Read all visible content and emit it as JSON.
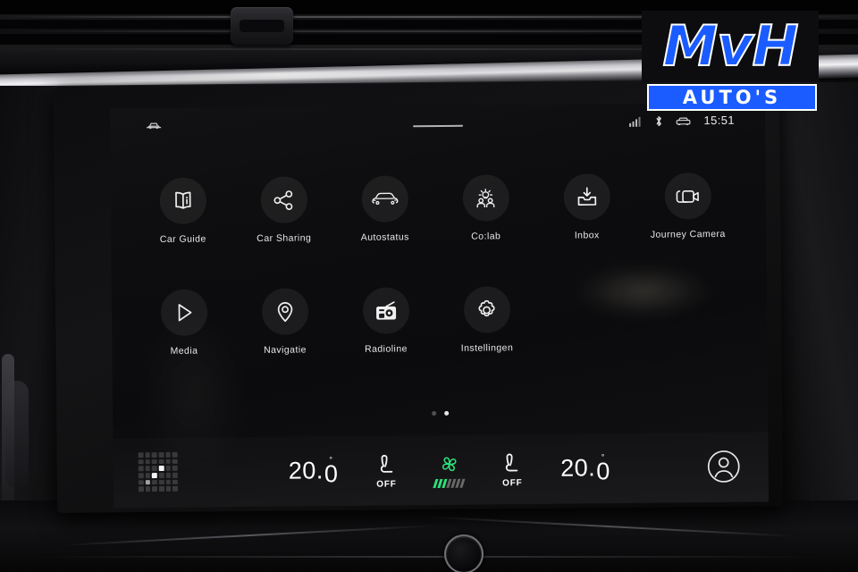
{
  "watermark": {
    "brand": "MvH",
    "tagline": "AUTO'S",
    "brand_color": "#1a5cff",
    "outline_color": "#ffffff"
  },
  "screen": {
    "status_bar": {
      "vehicle_icon": "car-icon",
      "signal_icon": "signal-bars-icon",
      "bluetooth_icon": "bluetooth-icon",
      "car_status_icon": "car-front-icon",
      "time": "15:51",
      "pull_handle": "drag-handle"
    },
    "apps": [
      [
        {
          "label": "Car Guide",
          "icon": "book-icon"
        },
        {
          "label": "Car Sharing",
          "icon": "share-icon"
        },
        {
          "label": "Autostatus",
          "icon": "car-front-icon"
        },
        {
          "label": "Co:lab",
          "icon": "collaboration-idea-icon"
        },
        {
          "label": "Inbox",
          "icon": "inbox-download-icon"
        },
        {
          "label": "Journey Camera",
          "icon": "video-camera-icon"
        }
      ],
      [
        {
          "label": "Media",
          "icon": "play-triangle-icon"
        },
        {
          "label": "Navigatie",
          "icon": "map-pin-icon"
        },
        {
          "label": "Radioline",
          "icon": "radio-icon"
        },
        {
          "label": "Instellingen",
          "icon": "gear-icon"
        }
      ]
    ],
    "pagination": {
      "total": 2,
      "active": 2
    },
    "climate": {
      "launcher_icon": "app-launcher-grid-icon",
      "left_temperature": {
        "whole": "20.",
        "fraction": "0",
        "degree": "°"
      },
      "right_temperature": {
        "whole": "20.",
        "fraction": "0",
        "degree": "°"
      },
      "left_seat": {
        "icon": "seat-heater-icon",
        "state": "OFF"
      },
      "right_seat": {
        "icon": "seat-heater-icon",
        "state": "OFF"
      },
      "fan": {
        "icon": "fan-blower-icon",
        "level": 3,
        "max_level": 7,
        "active_color": "#2ee07a"
      },
      "profile_icon": "user-avatar-icon"
    }
  }
}
